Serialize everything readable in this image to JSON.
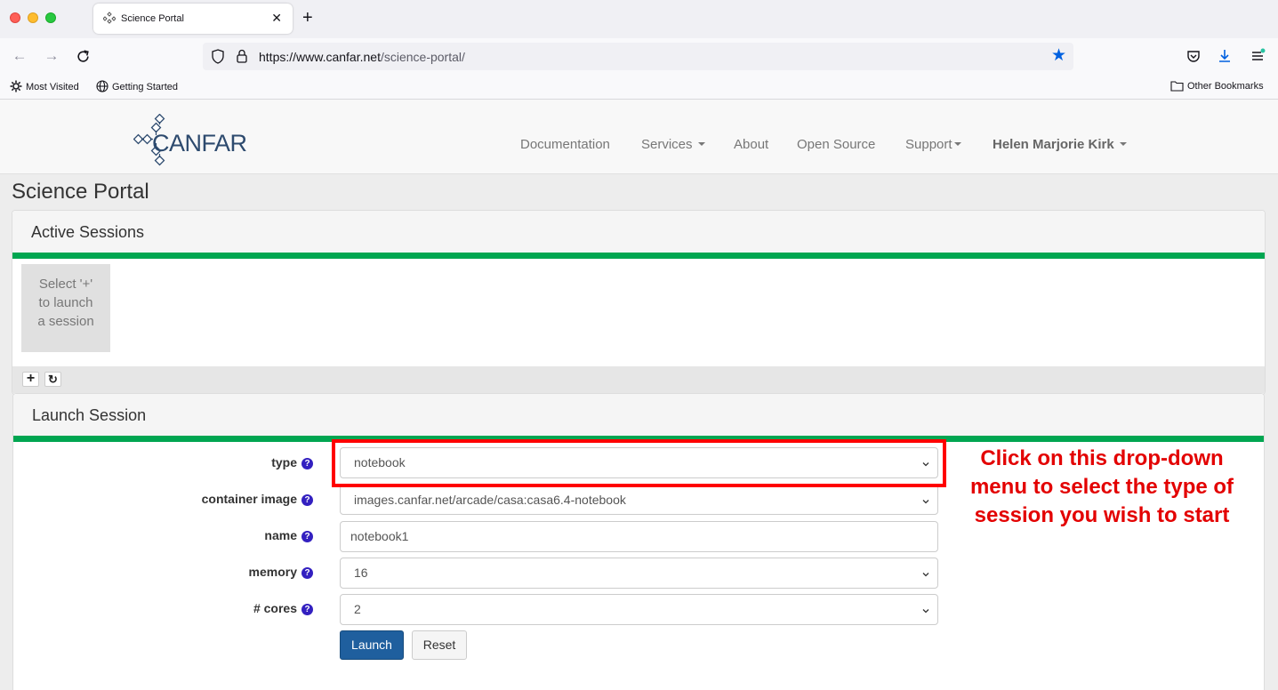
{
  "browser": {
    "tab_title": "Science Portal",
    "new_tab": "+",
    "url_host": "https://www.canfar.net",
    "url_path": "/science-portal/",
    "bookmarks": [
      "Most Visited",
      "Getting Started"
    ],
    "other_bookmarks": "Other Bookmarks"
  },
  "site": {
    "logo_text": "CANFAR",
    "nav": {
      "documentation": "Documentation",
      "services": "Services",
      "about": "About",
      "open_source": "Open Source",
      "support": "Support",
      "user": "Helen Marjorie Kirk"
    }
  },
  "page_title": "Science Portal",
  "active_sessions": {
    "heading": "Active Sessions",
    "placeholder_lines": [
      "Select '+'",
      "to launch",
      "a session"
    ],
    "add_button": "+",
    "refresh_button": "↻"
  },
  "launch_session": {
    "heading": "Launch Session",
    "fields": {
      "type": {
        "label": "type",
        "value": "notebook"
      },
      "container_image": {
        "label": "container image",
        "value": "images.canfar.net/arcade/casa:casa6.4-notebook"
      },
      "name": {
        "label": "name",
        "value": "notebook1"
      },
      "memory": {
        "label": "memory",
        "value": "16"
      },
      "cores": {
        "label": "# cores",
        "value": "2"
      }
    },
    "help_glyph": "?",
    "launch_button": "Launch",
    "reset_button": "Reset"
  },
  "annotation": {
    "text_lines": [
      "Click on this drop-down",
      "menu to select the type of",
      "session you wish to start"
    ],
    "color": "#e30000"
  },
  "colors": {
    "accent_green": "#00a651",
    "primary_button": "#1f5f9e",
    "help_icon": "#3320c0",
    "highlight_red": "#ff0000"
  }
}
